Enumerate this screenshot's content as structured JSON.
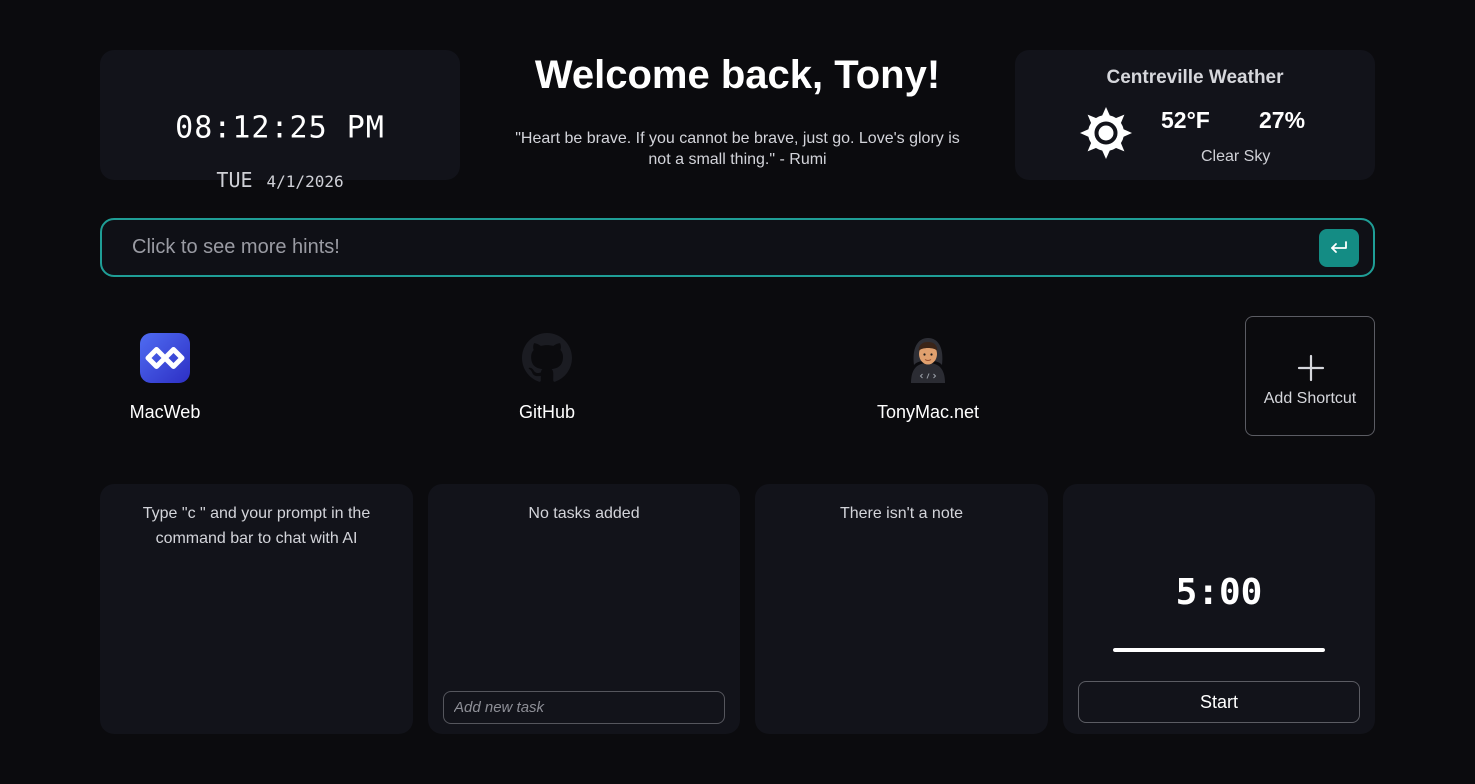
{
  "clock": {
    "time": "08:12:25 PM",
    "day": "TUE",
    "date": "4/1/2026"
  },
  "welcome": {
    "title": "Welcome back, Tony!",
    "quote": "\"Heart be brave. If you cannot be brave, just go. Love's glory is not a small thing.\" - Rumi"
  },
  "weather": {
    "location": "Centreville Weather",
    "icon": "sun-icon",
    "temperature": "52°F",
    "humidity": "27%",
    "condition": "Clear Sky"
  },
  "search": {
    "placeholder": "Click to see more hints!",
    "value": "",
    "submit_icon": "enter-return-icon",
    "accent_color": "#1f9e96"
  },
  "shortcuts": [
    {
      "label": "MacWeb",
      "icon": "macweb-logo-icon"
    },
    {
      "label": "GitHub",
      "icon": "github-icon"
    },
    {
      "label": "TonyMac.net",
      "icon": "tonymac-avatar-icon"
    }
  ],
  "add_shortcut": {
    "label": "Add Shortcut",
    "icon": "plus-icon"
  },
  "widgets": {
    "ai": {
      "message": "Type \"c \" and your prompt in the command bar to chat with AI"
    },
    "tasks": {
      "empty_message": "No tasks added",
      "input_placeholder": "Add new task"
    },
    "notes": {
      "empty_message": "There isn't a note"
    },
    "timer": {
      "display": "5:00",
      "progress_fraction": 1.0,
      "start_label": "Start"
    }
  }
}
